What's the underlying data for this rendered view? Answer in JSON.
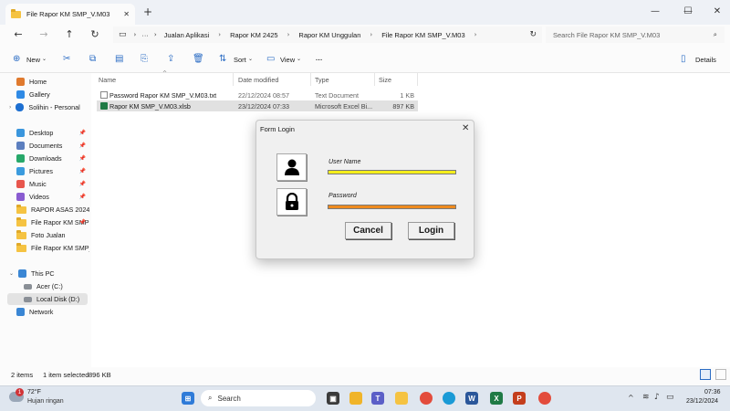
{
  "window": {
    "tab_title": "File Rapor KM SMP_V.M03",
    "controls": {
      "minimize": "—",
      "maximize": "☐",
      "close": "✕"
    }
  },
  "address": {
    "crumbs": [
      "Jualan Aplikasi",
      "Rapor KM 2425",
      "Rapor KM Unggulan",
      "File Rapor KM SMP_V.M03"
    ],
    "ellipsis": "···",
    "search_placeholder": "Search File Rapor KM SMP_V.M03"
  },
  "toolbar": {
    "new_label": "New",
    "sort_label": "Sort",
    "view_label": "View",
    "more_label": "···",
    "details_label": "Details"
  },
  "sidebar": {
    "items": [
      {
        "label": "Home",
        "icon": "home-icon"
      },
      {
        "label": "Gallery",
        "icon": "gallery-icon"
      },
      {
        "label": "Solihin - Personal",
        "icon": "cloud-icon"
      },
      {
        "label": "Desktop",
        "icon": "desktop-icon"
      },
      {
        "label": "Documents",
        "icon": "documents-icon"
      },
      {
        "label": "Downloads",
        "icon": "downloads-icon"
      },
      {
        "label": "Pictures",
        "icon": "pictures-icon"
      },
      {
        "label": "Music",
        "icon": "music-icon"
      },
      {
        "label": "Videos",
        "icon": "videos-icon"
      },
      {
        "label": "RAPOR ASAS 2024",
        "icon": "folder-icon"
      },
      {
        "label": "File Rapor KM SMP",
        "icon": "folder-icon"
      },
      {
        "label": "Foto Jualan",
        "icon": "folder-icon"
      },
      {
        "label": "File Rapor KM SMP_V",
        "icon": "folder-icon"
      },
      {
        "label": "This PC",
        "icon": "pc-icon"
      },
      {
        "label": "Acer (C:)",
        "icon": "drive-icon"
      },
      {
        "label": "Local Disk (D:)",
        "icon": "drive-icon"
      },
      {
        "label": "Network",
        "icon": "network-icon"
      }
    ]
  },
  "files": {
    "headers": {
      "name": "Name",
      "date": "Date modified",
      "type": "Type",
      "size": "Size"
    },
    "rows": [
      {
        "name": "Password Rapor KM SMP_V.M03.txt",
        "date": "22/12/2024 08:57",
        "type": "Text Document",
        "size": "1 KB"
      },
      {
        "name": "Rapor KM SMP_V.M03.xlsb",
        "date": "23/12/2024 07:33",
        "type": "Microsoft Excel Bi...",
        "size": "897 KB"
      }
    ]
  },
  "status": {
    "items": "2 items",
    "selected": "1 item selected",
    "size": "896 KB"
  },
  "dialog": {
    "title": "Form Login",
    "close": "✕",
    "username_label": "User Name",
    "password_label": "Password",
    "cancel_label": "Cancel",
    "login_label": "Login",
    "username_bar_color": "#f5ee1c",
    "password_bar_color": "#ee8a1e"
  },
  "taskbar": {
    "weather_temp": "72°F",
    "weather_desc": "Hujan ringan",
    "notification_count": "1",
    "search_label": "Search",
    "time": "07:36",
    "date": "23/12/2024"
  }
}
